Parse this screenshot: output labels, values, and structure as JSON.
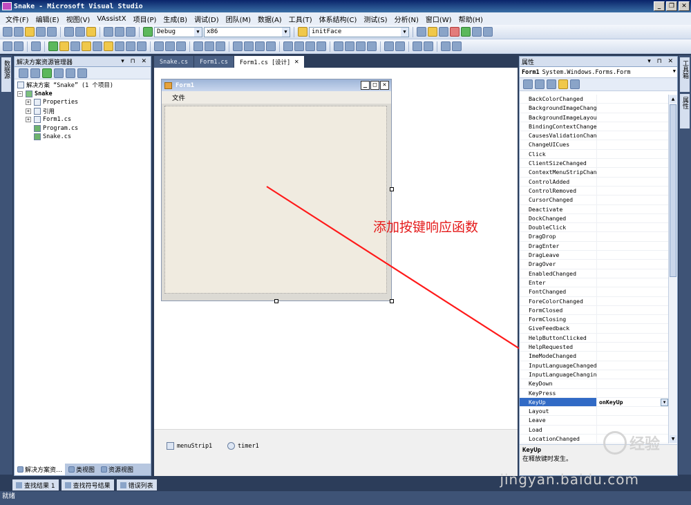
{
  "window": {
    "title": "Snake - Microsoft Visual Studio",
    "buttons": [
      "_",
      "❐",
      "✕"
    ]
  },
  "menu": [
    "文件(F)",
    "编辑(E)",
    "视图(V)",
    "VAssistX",
    "项目(P)",
    "生成(B)",
    "调试(D)",
    "团队(M)",
    "数据(A)",
    "工具(T)",
    "体系结构(C)",
    "测试(S)",
    "分析(N)",
    "窗口(W)",
    "帮助(H)"
  ],
  "toolbar": {
    "config": "Debug",
    "platform": "x86",
    "find": "initFace"
  },
  "left_strip": {
    "tab": "数据源"
  },
  "right_strip": {
    "tab1": "工具箱",
    "tab2": "属性"
  },
  "solution_explorer": {
    "title": "解决方案资源管理器",
    "pin": "▾ ⊓ ✕",
    "items": [
      {
        "label": "解决方案 “Snake” (1 个项目)",
        "indent": 0
      },
      {
        "label": "Snake",
        "indent": 1
      },
      {
        "label": "Properties",
        "indent": 2
      },
      {
        "label": "引用",
        "indent": 2
      },
      {
        "label": "Form1.cs",
        "indent": 2
      },
      {
        "label": "Program.cs",
        "indent": 2
      },
      {
        "label": "Snake.cs",
        "indent": 2
      }
    ],
    "tabs": [
      "解决方案资…",
      "类视图",
      "资源视图"
    ]
  },
  "doc_tabs": [
    "Snake.cs",
    "Form1.cs",
    "Form1.cs [设计]"
  ],
  "form": {
    "title": "Form1",
    "menu_item": "文件"
  },
  "tray": [
    "menuStrip1",
    "timer1"
  ],
  "annotation": "添加按键响应函数",
  "properties": {
    "title": "属性",
    "object_name": "Form1",
    "object_type": "System.Windows.Forms.Form",
    "events": [
      "BackColorChanged",
      "BackgroundImageChange",
      "BackgroundImageLayout",
      "BindingContextChanged",
      "CausesValidationChang",
      "ChangeUICues",
      "Click",
      "ClientSizeChanged",
      "ContextMenuStripChang",
      "ControlAdded",
      "ControlRemoved",
      "CursorChanged",
      "Deactivate",
      "DockChanged",
      "DoubleClick",
      "DragDrop",
      "DragEnter",
      "DragLeave",
      "DragOver",
      "EnabledChanged",
      "Enter",
      "FontChanged",
      "ForeColorChanged",
      "FormClosed",
      "FormClosing",
      "GiveFeedback",
      "HelpButtonClicked",
      "HelpRequested",
      "ImeModeChanged",
      "InputLanguageChanged",
      "InputLanguageChanging",
      "KeyDown",
      "KeyPress",
      "KeyUp",
      "Layout",
      "Leave",
      "Load",
      "LocationChanged"
    ],
    "selected_event": "KeyUp",
    "selected_value": "onKeyUp",
    "desc_title": "KeyUp",
    "desc_text": "在释放键时发生。"
  },
  "bottom_tabs": [
    "查找结果 1",
    "查找符号结果",
    "错误列表"
  ],
  "status": "就绪",
  "watermark": {
    "brand": "经验",
    "url": "jingyan.baidu.com"
  }
}
